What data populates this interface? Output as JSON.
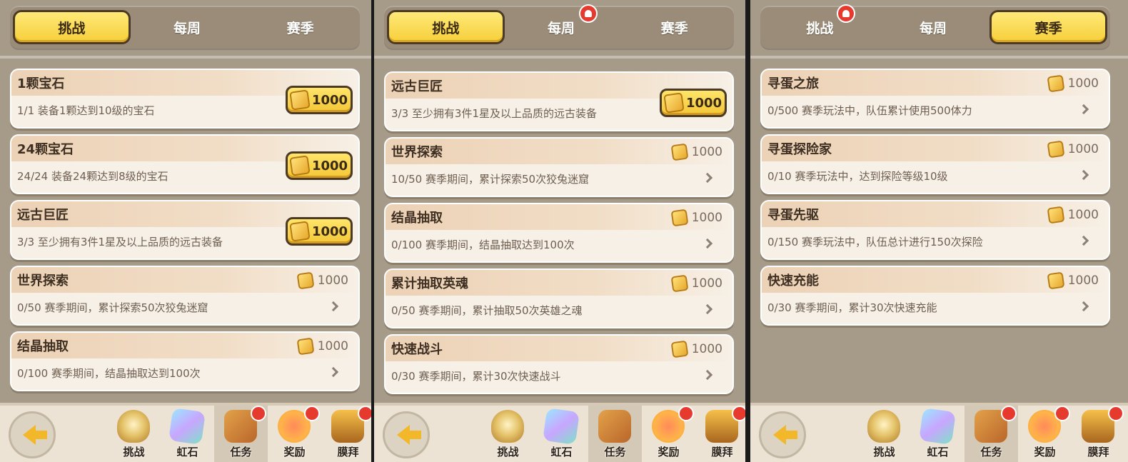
{
  "tabs": [
    "挑战",
    "每周",
    "赛季"
  ],
  "nav": [
    "挑战",
    "虹石",
    "任务",
    "奖励",
    "膜拜"
  ],
  "panels": [
    {
      "active_tab": 0,
      "tab_bell": null,
      "cards": [
        {
          "title": "1颗宝石",
          "desc": "1/1 装备1颗达到10级的宝石",
          "reward": "1000",
          "claimable": true
        },
        {
          "title": "24颗宝石",
          "desc": "24/24 装备24颗达到8级的宝石",
          "reward": "1000",
          "claimable": true
        },
        {
          "title": "远古巨匠",
          "desc": "3/3 至少拥有3件1星及以上品质的远古装备",
          "reward": "1000",
          "claimable": true
        },
        {
          "title": "世界探索",
          "desc": "0/50 赛季期间，累计探索50次狡兔迷窟",
          "reward": "1000",
          "claimable": false
        },
        {
          "title": "结晶抽取",
          "desc": "0/100 赛季期间，结晶抽取达到100次",
          "reward": "1000",
          "claimable": false
        }
      ]
    },
    {
      "active_tab": 0,
      "tab_bell": 1,
      "cards": [
        {
          "title": "远古巨匠",
          "desc": "3/3 至少拥有3件1星及以上品质的远古装备",
          "reward": "1000",
          "claimable": true
        },
        {
          "title": "世界探索",
          "desc": "10/50 赛季期间，累计探索50次狡兔迷窟",
          "reward": "1000",
          "claimable": false
        },
        {
          "title": "结晶抽取",
          "desc": "0/100 赛季期间，结晶抽取达到100次",
          "reward": "1000",
          "claimable": false
        },
        {
          "title": "累计抽取英魂",
          "desc": "0/50 赛季期间，累计抽取50次英雄之魂",
          "reward": "1000",
          "claimable": false
        },
        {
          "title": "快速战斗",
          "desc": "0/30 赛季期间，累计30次快速战斗",
          "reward": "1000",
          "claimable": false
        }
      ]
    },
    {
      "active_tab": 2,
      "tab_bell": 0,
      "cards": [
        {
          "title": "寻蛋之旅",
          "desc": "0/500 赛季玩法中，队伍累计使用500体力",
          "reward": "1000",
          "claimable": false
        },
        {
          "title": "寻蛋探险家",
          "desc": "0/10 赛季玩法中，达到探险等级10级",
          "reward": "1000",
          "claimable": false
        },
        {
          "title": "寻蛋先驱",
          "desc": "0/150 赛季玩法中，队伍总计进行150次探险",
          "reward": "1000",
          "claimable": false
        },
        {
          "title": "快速充能",
          "desc": "0/30 赛季期间，累计30次快速充能",
          "reward": "1000",
          "claimable": false
        }
      ]
    }
  ]
}
